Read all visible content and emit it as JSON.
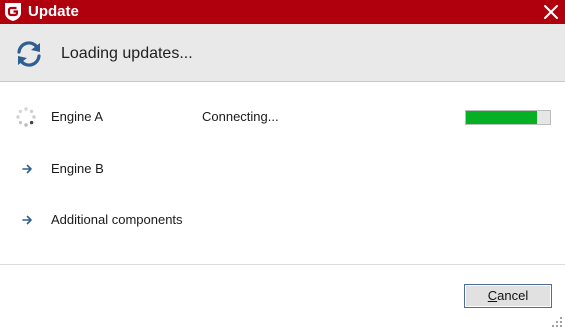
{
  "window": {
    "title": "Update"
  },
  "header": {
    "heading": "Loading updates..."
  },
  "rows": [
    {
      "label": "Engine A",
      "status": "Connecting...",
      "state": "in-progress",
      "progress": 0.84,
      "icon": "loading-spinner-icon"
    },
    {
      "label": "Engine B",
      "status": "",
      "state": "pending",
      "icon": "arrow-right-icon"
    },
    {
      "label": "Additional components",
      "status": "",
      "state": "pending",
      "icon": "arrow-right-icon"
    }
  ],
  "buttons": {
    "cancel_accel": "C",
    "cancel_rest": "ancel"
  },
  "colors": {
    "titlebar": "#b0000d",
    "header_bg": "#e9e9e9",
    "progress_fill": "#06b025",
    "icon_blue": "#2e5f90"
  }
}
